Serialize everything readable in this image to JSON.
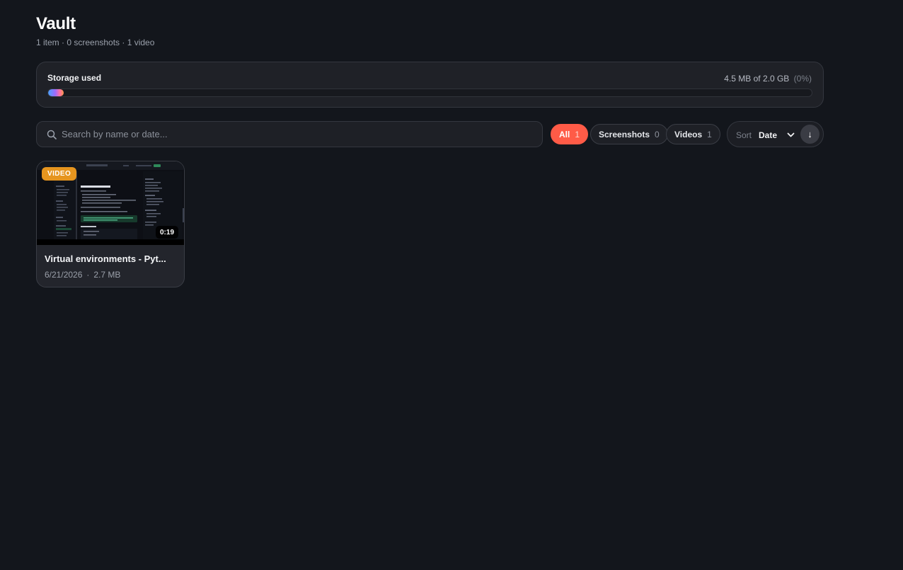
{
  "header": {
    "title": "Vault",
    "subtitle": "1 item · 0 screenshots · 1 video"
  },
  "storage": {
    "label": "Storage used",
    "amount": "4.5 MB of 2.0 GB",
    "percent_text": "(0%)",
    "fraction_used": 0.002
  },
  "search": {
    "placeholder": "Search by name or date...",
    "value": ""
  },
  "filters": [
    {
      "label": "All",
      "count": "1",
      "active": true
    },
    {
      "label": "Screenshots",
      "count": "0",
      "active": false
    },
    {
      "label": "Videos",
      "count": "1",
      "active": false
    }
  ],
  "sort": {
    "label": "Sort",
    "value": "Date",
    "direction_glyph": "↓",
    "direction_icon": "arrow-down-icon"
  },
  "items": [
    {
      "type_badge": "VIDEO",
      "duration": "0:19",
      "title": "Virtual environments - Pyt...",
      "date": "6/21/2026",
      "separator": "·",
      "size": "2.7 MB"
    }
  ],
  "colors": {
    "accent": "#ff5b47",
    "video_badge": "#e6951f",
    "background": "#13161c"
  }
}
